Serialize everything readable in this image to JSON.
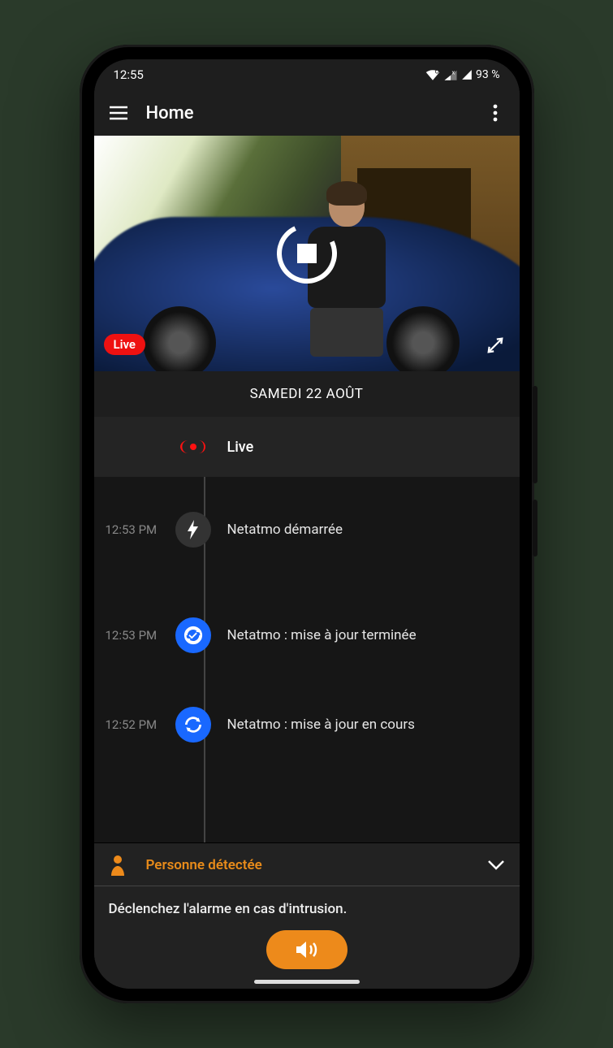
{
  "statusbar": {
    "time": "12:55",
    "battery": "93 %"
  },
  "header": {
    "title": "Home"
  },
  "camera": {
    "live_badge": "Live"
  },
  "date_header": "SAMEDI 22 AOÛT",
  "timeline": {
    "live_label": "Live",
    "events": [
      {
        "time": "12:53 PM",
        "icon": "bolt",
        "label": "Netatmo démarrée"
      },
      {
        "time": "12:53 PM",
        "icon": "sync",
        "label": "Netatmo : mise à jour terminée"
      },
      {
        "time": "12:52 PM",
        "icon": "sync",
        "label": "Netatmo : mise à jour en cours"
      }
    ]
  },
  "detection": {
    "label": "Personne détectée",
    "alarm_hint": "Déclenchez l'alarme en cas d'intrusion."
  },
  "colors": {
    "accent": "#ed8a1b",
    "live_red": "#e31717",
    "sync_blue": "#1968ff",
    "bg": "#1e1e1e"
  }
}
